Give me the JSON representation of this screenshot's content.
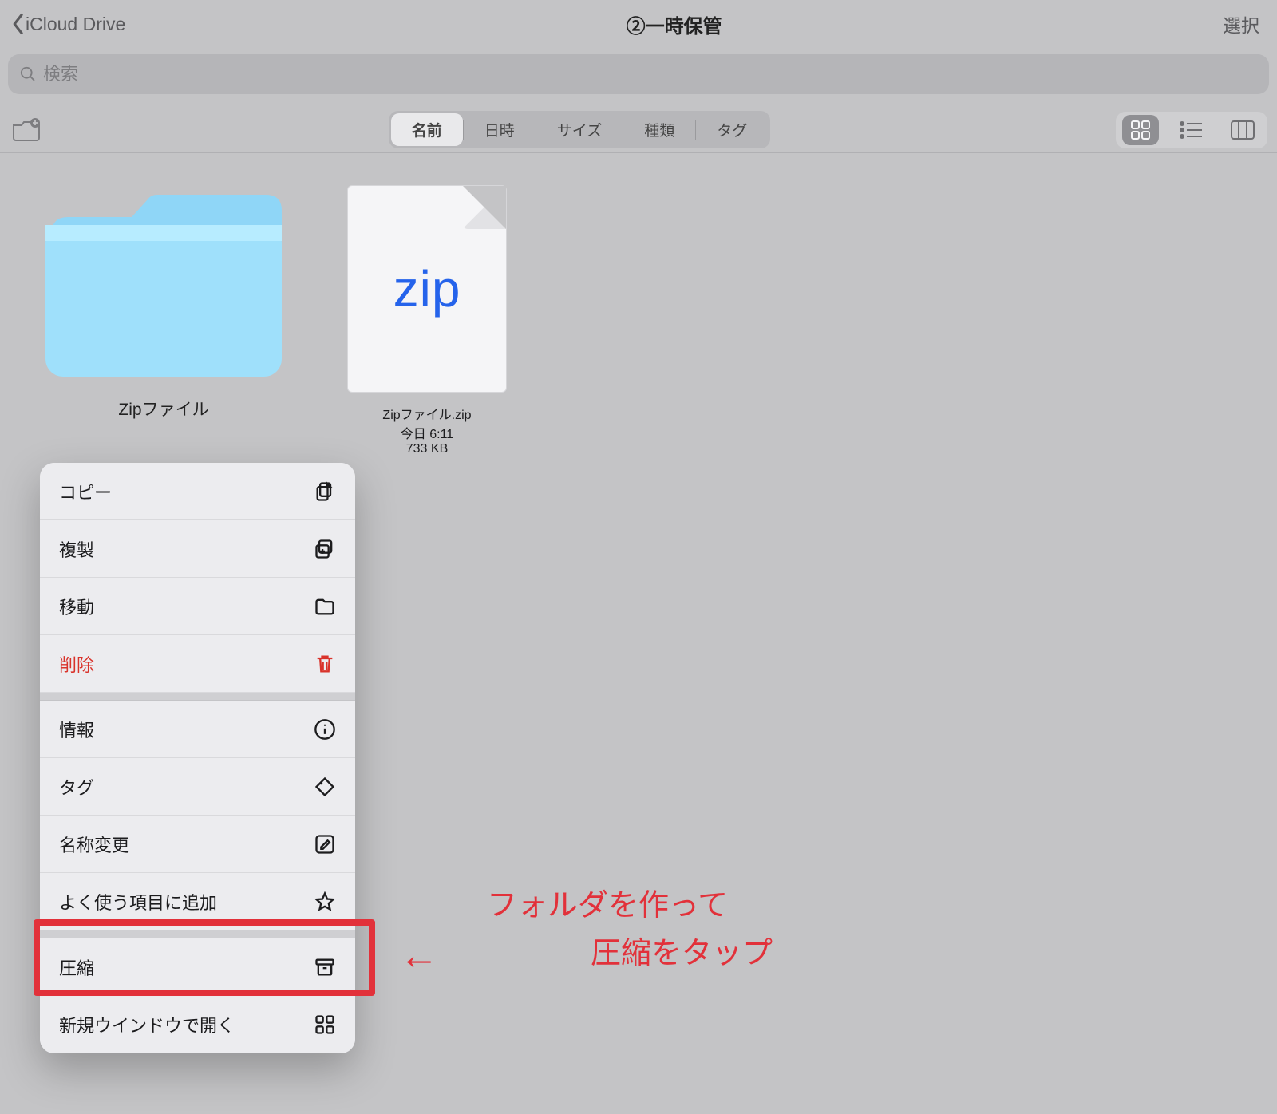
{
  "nav": {
    "back_label": "iCloud Drive",
    "title": "②一時保管",
    "select_label": "選択"
  },
  "search": {
    "placeholder": "検索"
  },
  "sort_segments": {
    "name": "名前",
    "date": "日時",
    "size": "サイズ",
    "kind": "種類",
    "tag": "タグ"
  },
  "items": {
    "folder": {
      "name": "Zipファイル"
    },
    "zipfile": {
      "name": "Zipファイル.zip",
      "date": "今日 6:11",
      "size": "733 KB",
      "thumb_text": "zip"
    }
  },
  "context_menu": {
    "copy": "コピー",
    "duplicate": "複製",
    "move": "移動",
    "delete": "削除",
    "info": "情報",
    "tags": "タグ",
    "rename": "名称変更",
    "favorite": "よく使う項目に追加",
    "compress": "圧縮",
    "new_window": "新規ウインドウで開く"
  },
  "annotation": {
    "line1": "フォルダを作って",
    "line2": "圧縮をタップ",
    "arrow": "←"
  }
}
